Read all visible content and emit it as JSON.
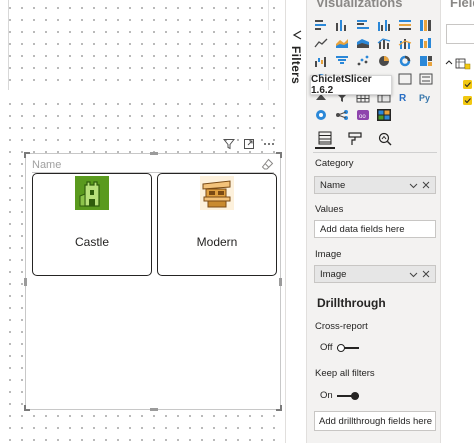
{
  "slicer": {
    "header_title": "Name",
    "items": [
      {
        "label": "Castle",
        "icon": "castle-icon"
      },
      {
        "label": "Modern",
        "icon": "modern-building-icon"
      }
    ]
  },
  "filters_pane": {
    "label": "Filters"
  },
  "visualizations_pane": {
    "title": "Visualizations",
    "tooltip": "ChicletSlicer 1.6.2",
    "wells": {
      "category": {
        "label": "Category",
        "field": "Name"
      },
      "values": {
        "label": "Values",
        "placeholder": "Add data fields here"
      },
      "image": {
        "label": "Image",
        "field": "Image"
      }
    },
    "drillthrough": {
      "title": "Drillthrough",
      "cross_report": {
        "label": "Cross-report",
        "state": "Off"
      },
      "keep_all_filters": {
        "label": "Keep all filters",
        "state": "On"
      },
      "add_button": "Add drillthrough fields here"
    }
  },
  "fields_pane": {
    "title": "Fields"
  },
  "colors": {
    "accent_dark": "#252423",
    "pane_bg": "#f3f2f1",
    "checkbox_yellow": "#f2c811",
    "castle_green": "#5a9a1e",
    "modern_orange": "#e0a040"
  }
}
